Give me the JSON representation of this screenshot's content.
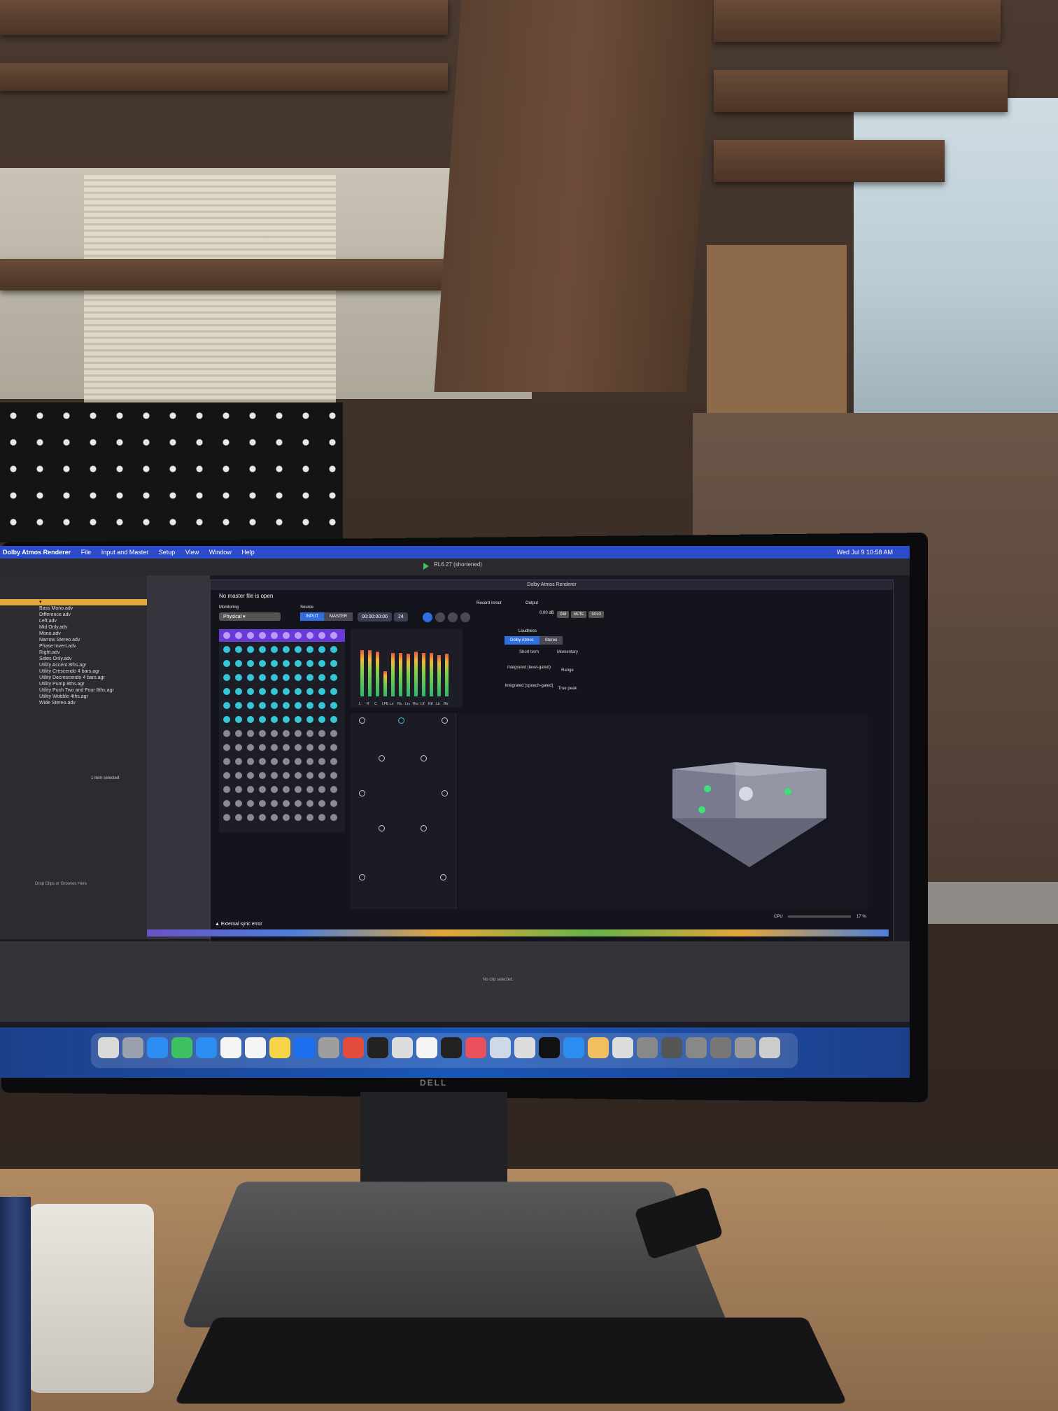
{
  "menubar": {
    "app_name": "Dolby Atmos Renderer",
    "items": [
      "File",
      "Input and Master",
      "Setup",
      "View",
      "Window",
      "Help"
    ],
    "clock": "Wed Jul 9 10:58 AM"
  },
  "live": {
    "transport_title": "RL6.27 (shortened)",
    "browser_items": [
      "Bass Mono.adv",
      "Difference.adv",
      "Left.adv",
      "Mid Only.adv",
      "Mono.adv",
      "Narrow Stereo.adv",
      "Phase Invert.adv",
      "Right.adv",
      "Sides Only.adv",
      "Utility Accent 8ths.agr",
      "Utility Crescendo 4 bars.agr",
      "Utility Decrescendo 4 bars.agr",
      "Utility Pump 8ths.agr",
      "Utility Push Two and Four 8ths.agr",
      "Utility Wobble 4ths.agr",
      "Wide Stereo.adv"
    ],
    "browser_status": "1 item selected",
    "drop_hint": "Drop Clips or Grooves Here",
    "no_clip": "No clip selected."
  },
  "renderer": {
    "title": "Dolby Atmos Renderer",
    "status": "No master file is open",
    "monitoring_label": "Monitoring",
    "monitoring_value": "Physical",
    "source_label": "Source",
    "source_input": "INPUT",
    "source_master": "MASTER",
    "timecode": "00:00:00:00",
    "frame_rate": "24",
    "record_label": "Record in/out",
    "output_label": "Output",
    "output_value": "0.00 dB",
    "output_buttons": [
      "DIM",
      "MUTE",
      "SOLO"
    ],
    "loudness_label": "Loudness",
    "loudness_tabs": [
      "Dolby Atmos",
      "Stereo"
    ],
    "loudness_fields": [
      "Short term",
      "Momentary",
      "Integrated (level-gated)",
      "Range",
      "Integrated (speech-gated)",
      "True peak"
    ],
    "meter_labels": [
      "L",
      "R",
      "C",
      "LFE",
      "Ls",
      "Rs",
      "Lrs",
      "Rrs",
      "Ltf",
      "Rtf",
      "Ltr",
      "Rtr"
    ],
    "meter_levels": [
      0.82,
      0.82,
      0.8,
      0.45,
      0.78,
      0.78,
      0.76,
      0.8,
      0.77,
      0.78,
      0.74,
      0.76
    ],
    "sync_error": "External sync error",
    "cpu_label": "CPU",
    "cpu_value": "17 %"
  },
  "colors": {
    "menubar": "#2d4cc9",
    "accent": "#6b3ad6",
    "object_dot": "#37c6d8",
    "selection": "#e3a63b"
  },
  "monitor_brand": "DELL"
}
